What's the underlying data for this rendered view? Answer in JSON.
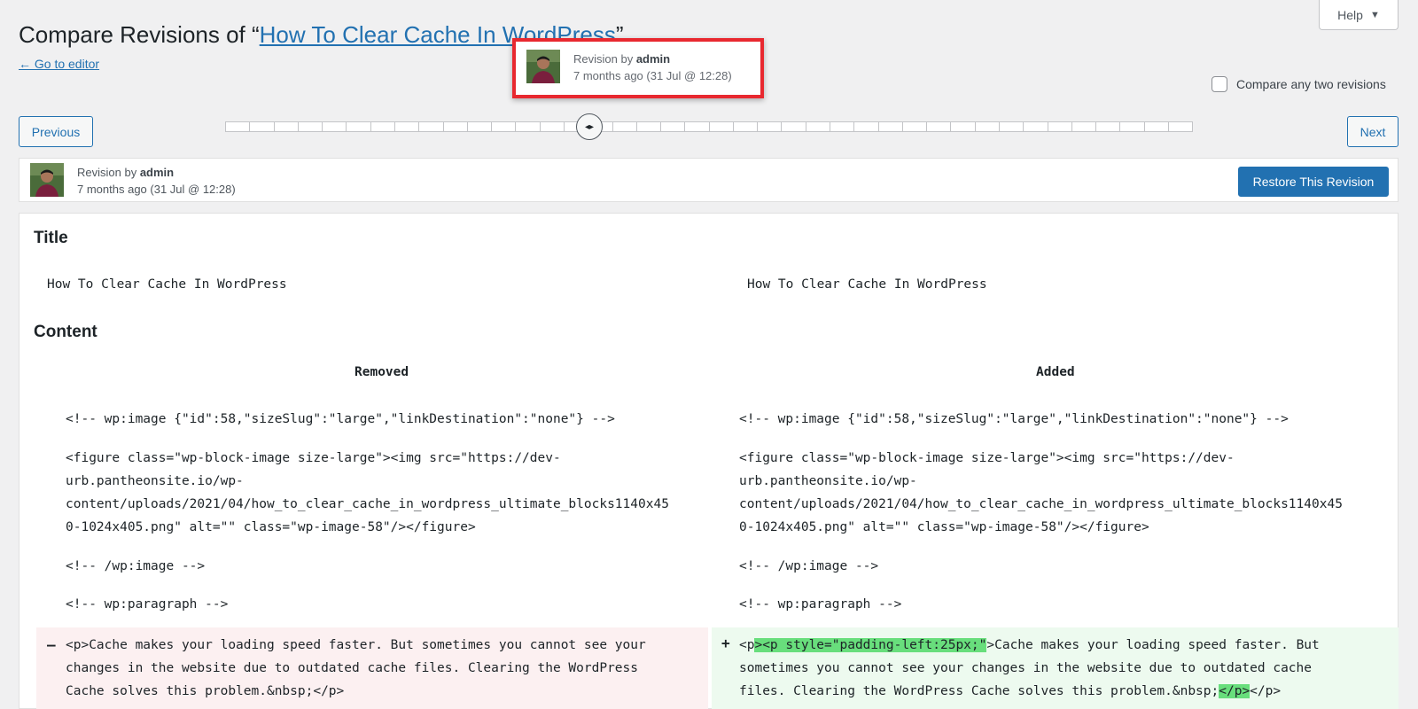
{
  "header": {
    "title_prefix": "Compare Revisions of “",
    "title_link": "How To Clear Cache In WordPress",
    "title_suffix": "”",
    "go_to_editor": "← Go to editor",
    "help_label": "Help"
  },
  "controls": {
    "compare_two_label": "Compare any two revisions",
    "previous_label": "Previous",
    "next_label": "Next",
    "slider_tick_count": 40,
    "slider_handle_index": 15
  },
  "tooltip": {
    "revision_by": "Revision by ",
    "author": "admin",
    "time": "7 months ago (31 Jul @ 12:28)"
  },
  "revision_meta": {
    "revision_by": "Revision by ",
    "author": "admin",
    "time": "7 months ago (31 Jul @ 12:28)",
    "restore_label": "Restore This Revision"
  },
  "diff": {
    "title_heading": "Title",
    "title_left": "How To Clear Cache In WordPress",
    "title_right": "How To Clear Cache In WordPress",
    "content_heading": "Content",
    "removed_label": "Removed",
    "added_label": "Added",
    "line_image_open": "<!-- wp:image {\"id\":58,\"sizeSlug\":\"large\",\"linkDestination\":\"none\"} -->",
    "figure_lines": [
      "<figure class=\"wp-block-image size-large\"><img src=\"https://dev-",
      "urb.pantheonsite.io/wp-",
      "content/uploads/2021/04/how_to_clear_cache_in_wordpress_ultimate_blocks1140x45",
      "0-1024x405.png\" alt=\"\" class=\"wp-image-58\"/></figure>"
    ],
    "line_image_close": "<!-- /wp:image -->",
    "line_paragraph_open": "<!-- wp:paragraph -->",
    "removed_lines": [
      "<p>Cache makes your loading speed faster. But sometimes you cannot see your",
      "changes in the website due to outdated cache files. Clearing the WordPress",
      "Cache solves this problem.&nbsp;</p>"
    ],
    "added": {
      "l1_pre": "<p",
      "l1_hl": "><p style=\"padding-left:25px;\"",
      "l1_post": ">Cache makes your loading speed faster. But",
      "l2": "sometimes you cannot see your changes in the website due to outdated cache",
      "l3_pre": "files. Clearing the WordPress Cache solves this problem.&nbsp;",
      "l3_hl": "</p>",
      "l3_post": "</p>"
    },
    "removed_sign": "–",
    "added_sign": "+"
  }
}
